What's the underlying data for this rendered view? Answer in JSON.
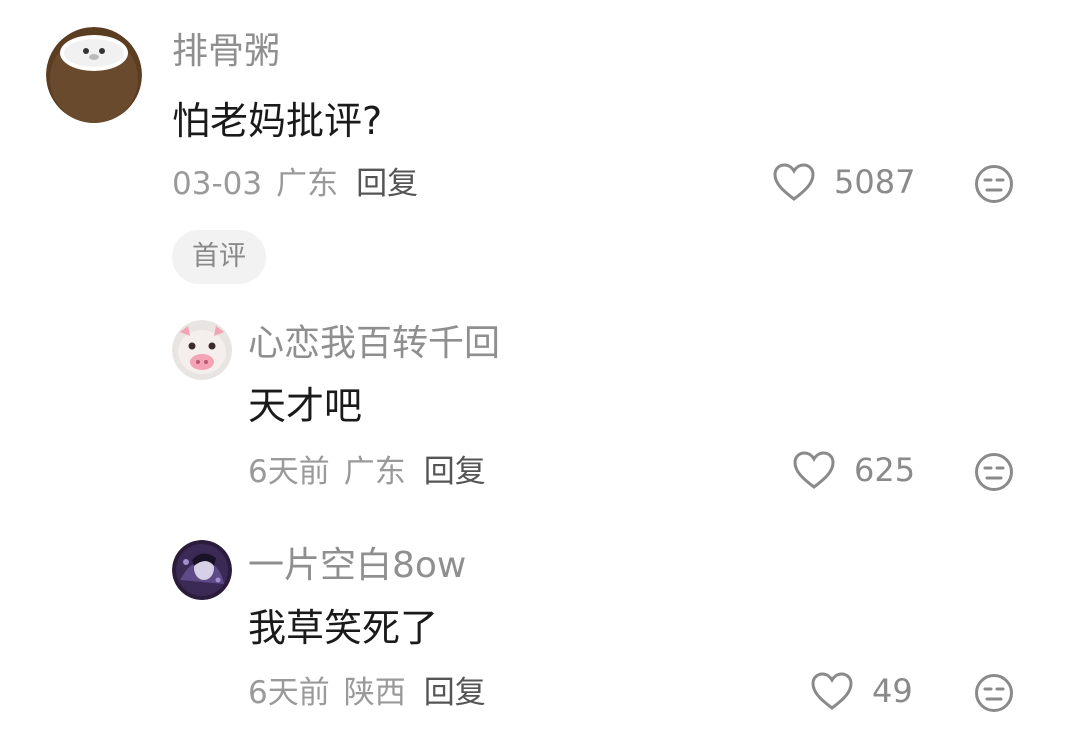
{
  "comments": [
    {
      "username": "排骨粥",
      "text": "怕老妈批评?",
      "date": "03-03",
      "location": "广东",
      "reply_label": "回复",
      "likes": "5087",
      "avatar_icon": "coconut-avatar"
    }
  ],
  "first_comment_badge": "首评",
  "replies": [
    {
      "username": "心恋我百转千回",
      "text": "天才吧",
      "date": "6天前",
      "location": "广东",
      "reply_label": "回复",
      "likes": "625",
      "avatar_icon": "pig-avatar"
    },
    {
      "username": "一片空白8ow",
      "text": "我草笑死了",
      "date": "6天前",
      "location": "陕西",
      "reply_label": "回复",
      "likes": "49",
      "avatar_icon": "anime-character-avatar"
    }
  ],
  "icons": {
    "like": "heart-outline-icon",
    "dislike": "meh-face-icon"
  },
  "colors": {
    "username": "#8f8f8f",
    "body_text": "#1a1a1a",
    "meta": "#9a9a9a",
    "badge_bg": "#f2f2f2"
  }
}
